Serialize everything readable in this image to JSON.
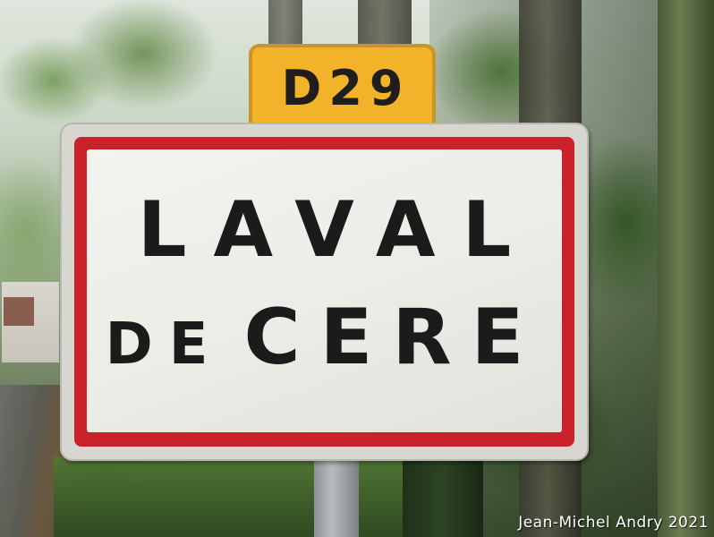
{
  "road_plate": {
    "label": "D29",
    "color": "#f2b22a"
  },
  "town_sign": {
    "line1": "LAVAL",
    "line2_prefix": "DE",
    "line2_main": "CERE",
    "border_color": "#c9222b",
    "background_color": "#f0f0ec"
  },
  "credit": {
    "text": "Jean-Michel Andry 2021"
  }
}
